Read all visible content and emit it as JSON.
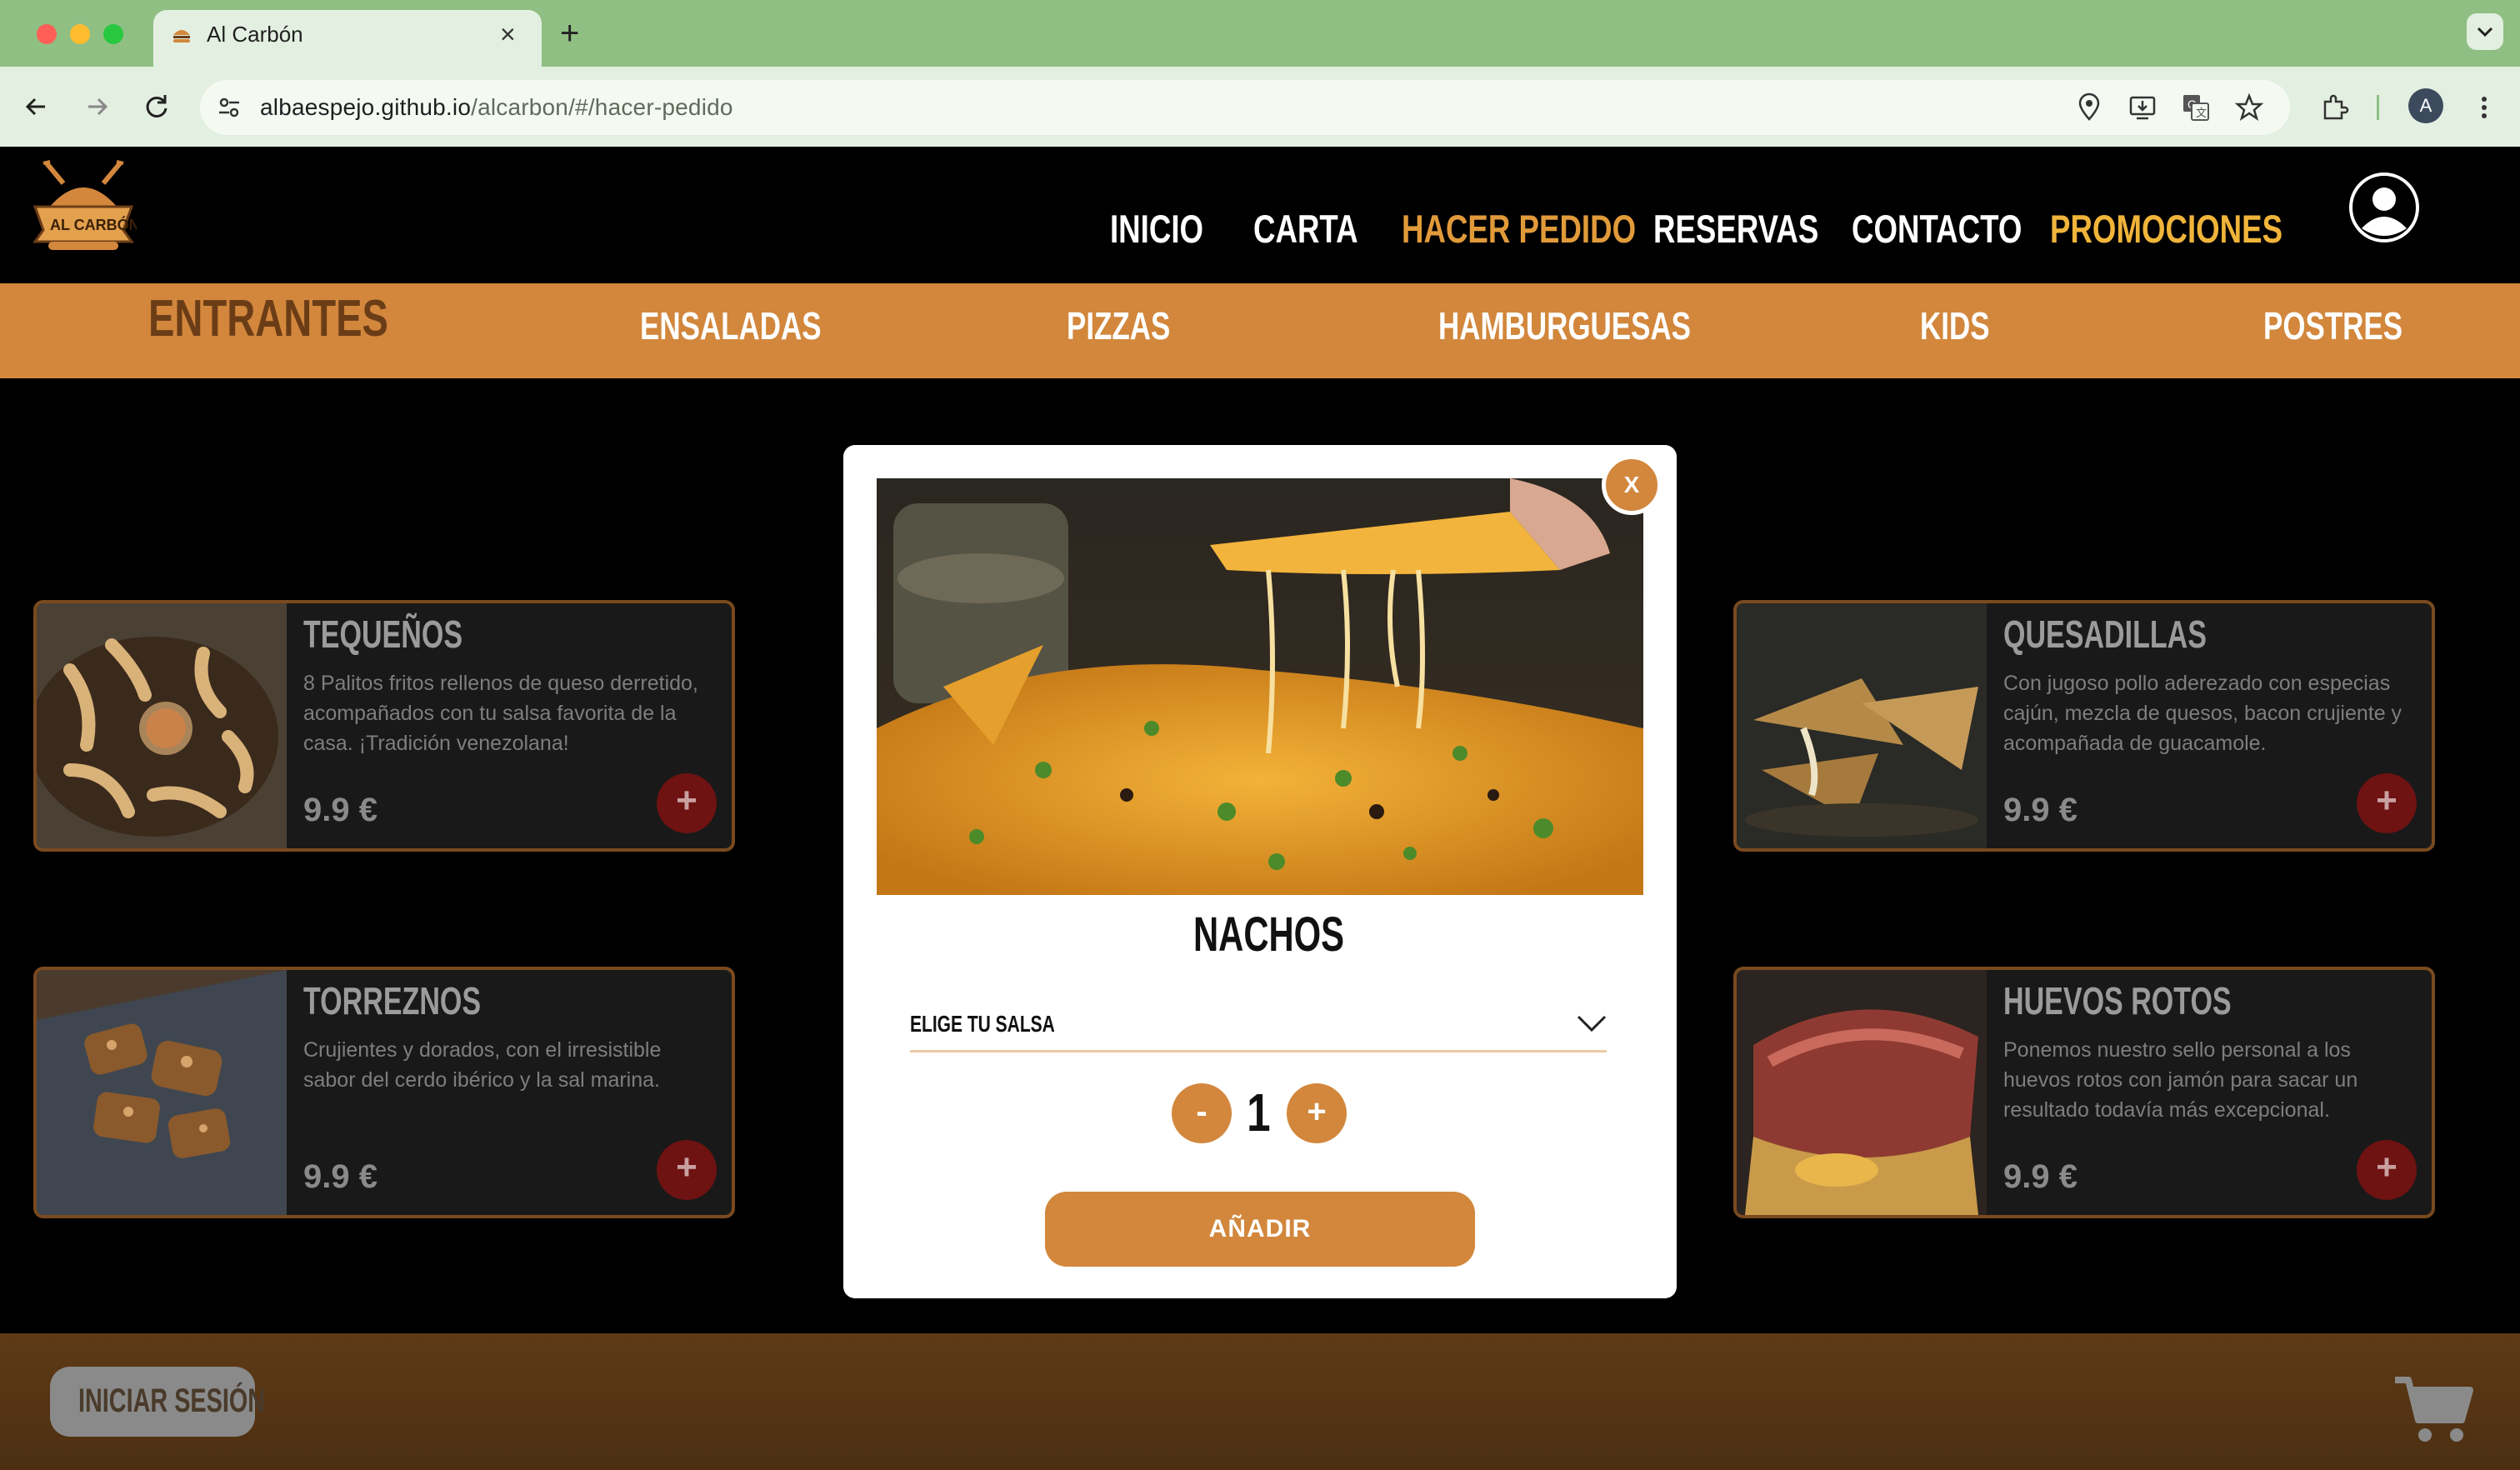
{
  "browser": {
    "tab_title": "Al Carbón",
    "tab_close": "×",
    "new_tab": "+",
    "url_host": "albaespejo.github.io",
    "url_path": "/alcarbon/#/hacer-pedido",
    "profile_initial": "A"
  },
  "site": {
    "nav": [
      "INICIO",
      "CARTA",
      "HACER PEDIDO",
      "RESERVAS",
      "CONTACTO",
      "PROMOCIONES"
    ],
    "categories": [
      "ENTRANTES",
      "ENSALADAS",
      "PIZZAS",
      "HAMBURGUESAS",
      "KIDS",
      "POSTRES"
    ],
    "active_category": "ENTRANTES",
    "colors": {
      "accent": "#d2873c",
      "dark_red": "#6e1212",
      "gold": "#f0b43a"
    }
  },
  "products": [
    {
      "title": "TEQUEÑOS",
      "desc": "8 Palitos fritos rellenos de queso derretido, acompañados con tu salsa favorita de la casa. ¡Tradición venezolana!",
      "price": "9.9 €",
      "add": "+"
    },
    {
      "title": "QUESADILLAS",
      "desc": "Con jugoso pollo aderezado con especias cajún, mezcla de quesos, bacon crujiente y acompañada de guacamole.",
      "price": "9.9 €",
      "add": "+"
    },
    {
      "title": "TORREZNOS",
      "desc": "Crujientes y dorados, con el irresistible sabor del cerdo ibérico y la sal marina.",
      "price": "9.9 €",
      "add": "+"
    },
    {
      "title": "HUEVOS ROTOS",
      "desc": "Ponemos nuestro sello personal a los huevos rotos con jamón para sacar un resultado todavía más excepcional.",
      "price": "9.9 €",
      "add": "+"
    }
  ],
  "modal": {
    "close": "X",
    "title": "NACHOS",
    "select_label": "ELIGE TU SALSA",
    "minus": "-",
    "quantity": "1",
    "plus": "+",
    "add_label": "AÑADIR"
  },
  "footer": {
    "login_label": "INICIAR SESIÓN"
  }
}
